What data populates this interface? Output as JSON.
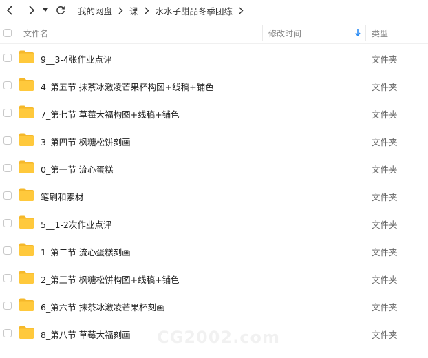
{
  "breadcrumb": [
    "我的网盘",
    "课",
    "水水子甜品冬季团练"
  ],
  "header": {
    "name_label": "文件名",
    "time_label": "修改时间",
    "type_label": "类型"
  },
  "rows": [
    {
      "name": "9__3-4张作业点评",
      "type": "文件夹"
    },
    {
      "name": "4_第五节 抹茶冰激凌芒果杯构图+线稿+铺色",
      "type": "文件夹"
    },
    {
      "name": "7_第七节 草莓大福构图+线稿+铺色",
      "type": "文件夹"
    },
    {
      "name": "3_第四节 枫糖松饼刻画",
      "type": "文件夹"
    },
    {
      "name": "0_第一节 流心蛋糕",
      "type": "文件夹"
    },
    {
      "name": "笔刷和素材",
      "type": "文件夹"
    },
    {
      "name": "5__1-2次作业点评",
      "type": "文件夹"
    },
    {
      "name": "1_第二节 流心蛋糕刻画",
      "type": "文件夹"
    },
    {
      "name": "2_第三节 枫糖松饼构图+线稿+铺色",
      "type": "文件夹"
    },
    {
      "name": "6_第六节 抹茶冰激凌芒果杯刻画",
      "type": "文件夹"
    },
    {
      "name": "8_第八节 草莓大福刻画",
      "type": "文件夹"
    }
  ],
  "watermark": "CG2002.com",
  "colors": {
    "folder": "#ffc93c",
    "folder_tab": "#f5b82a",
    "sort_arrow": "#2f8ef4"
  }
}
